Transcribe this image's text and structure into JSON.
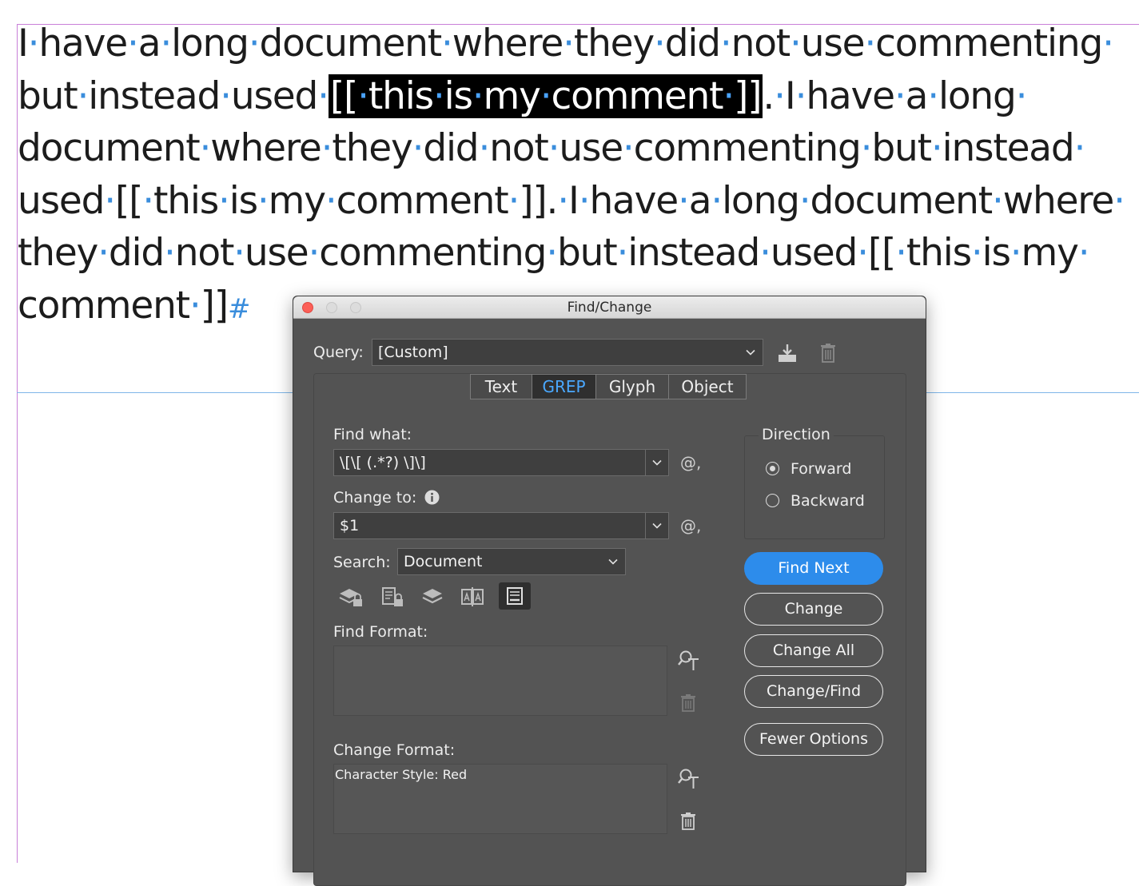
{
  "document": {
    "lines": [
      {
        "a": "I·have·a·long·document·where·they·did·not·use·commenting·"
      },
      {
        "a": "but·instead·used·",
        "hl": "[[·this·is·my·comment·]]",
        "b": ".·I·have·a·long·"
      },
      {
        "a": "document·where·they·did·not·use·commenting·but·instead·"
      },
      {
        "a": "used·[[·this·is·my·comment·]].·I·have·a·long·document·where·"
      },
      {
        "a": "they·did·not·use·commenting·but·instead·used·[[·this·is·my·"
      },
      {
        "a": "comment·]]",
        "end": "#"
      }
    ]
  },
  "dialog": {
    "title": "Find/Change",
    "query_label": "Query:",
    "query_value": "[Custom]",
    "tabs": [
      {
        "label": "Text",
        "active": false
      },
      {
        "label": "GREP",
        "active": true
      },
      {
        "label": "Glyph",
        "active": false
      },
      {
        "label": "Object",
        "active": false
      }
    ],
    "find_what_label": "Find what:",
    "find_what_value": "\\[\\[ (.*?) \\]\\]",
    "change_to_label": "Change to:",
    "change_to_value": "$1",
    "search_label": "Search:",
    "search_value": "Document",
    "direction_label": "Direction",
    "direction_options": [
      "Forward",
      "Backward"
    ],
    "direction_selected": "Forward",
    "find_format_label": "Find Format:",
    "find_format_value": "",
    "change_format_label": "Change Format:",
    "change_format_value": "Character Style: Red",
    "buttons": {
      "find_next": "Find Next",
      "change": "Change",
      "change_all": "Change All",
      "change_find": "Change/Find",
      "fewer_options": "Fewer Options"
    },
    "special_char_glyph": "@,",
    "info_glyph": "ℹ",
    "colors": {
      "accent": "#2d8ceb",
      "active_tab_text": "#4aa8ff",
      "panel_bg": "#535353"
    }
  }
}
